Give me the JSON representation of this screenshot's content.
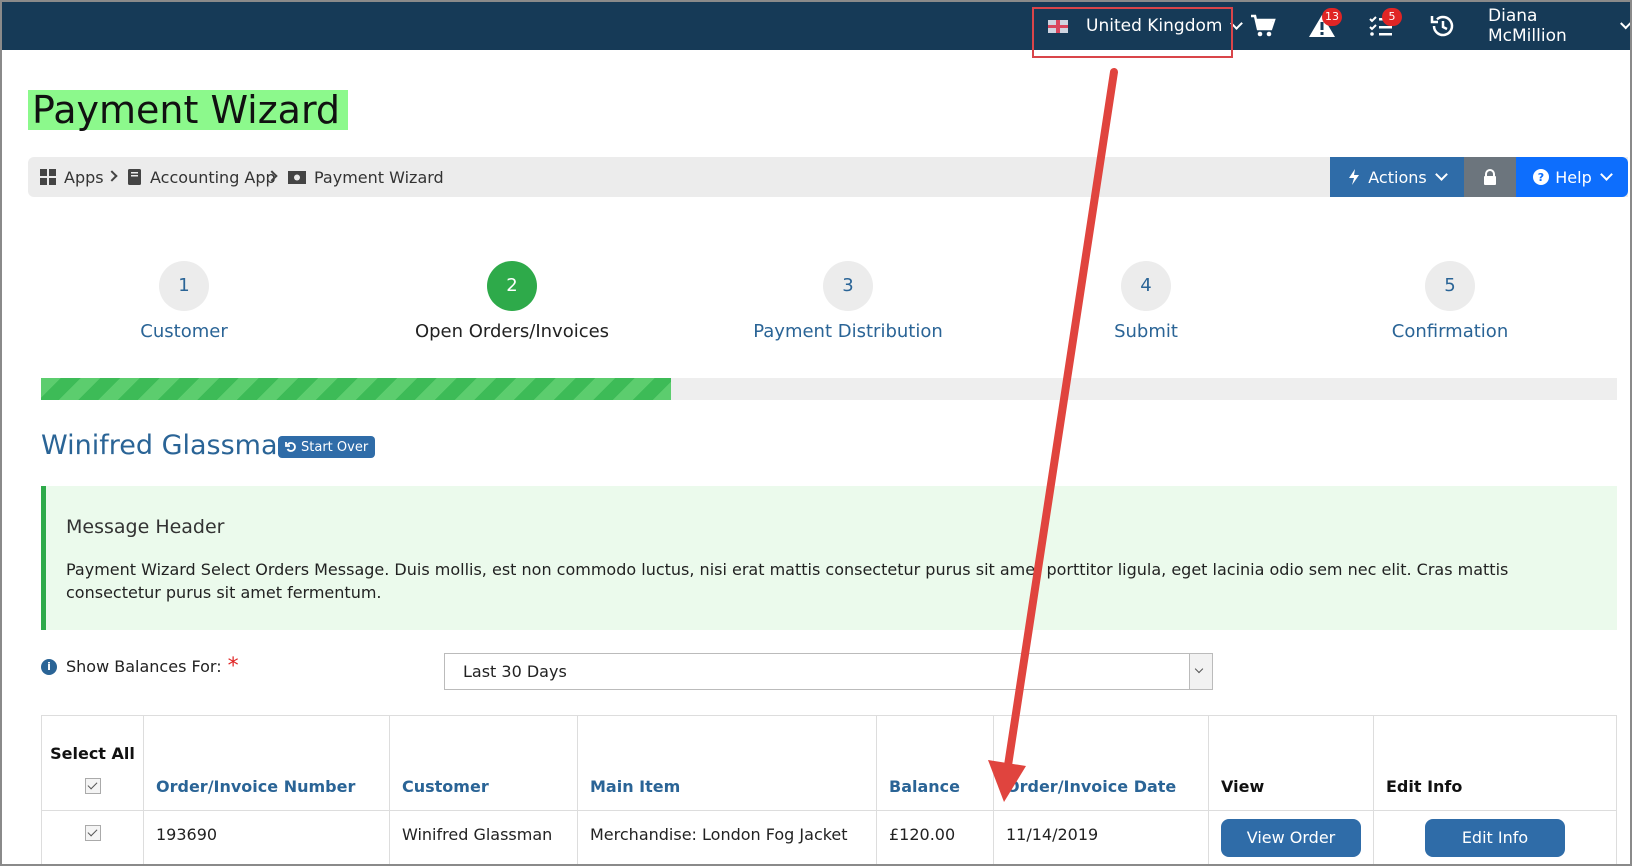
{
  "topbar": {
    "country": "United Kingdom",
    "alerts_count": "13",
    "tasks_count": "5",
    "user_name": "Diana McMillion"
  },
  "page": {
    "title": "Payment Wizard"
  },
  "breadcrumb": {
    "items": [
      "Apps",
      "Accounting App",
      "Payment Wizard"
    ],
    "actions_label": "Actions",
    "help_label": "Help"
  },
  "steps": [
    {
      "num": "1",
      "label": "Customer"
    },
    {
      "num": "2",
      "label": "Open Orders/Invoices"
    },
    {
      "num": "3",
      "label": "Payment Distribution"
    },
    {
      "num": "4",
      "label": "Submit"
    },
    {
      "num": "5",
      "label": "Confirmation"
    }
  ],
  "progress": {
    "percent": 40
  },
  "customer": {
    "name": "Winifred Glassman",
    "start_over": "Start Over"
  },
  "message": {
    "header": "Message Header",
    "body": "Payment Wizard Select Orders Message. Duis mollis, est non commodo luctus, nisi erat mattis consectetur purus sit amet porttitor ligula, eget lacinia odio sem nec elit. Cras mattis consectetur purus sit amet fermentum."
  },
  "filter": {
    "label": "Show Balances For:",
    "selected": "Last 30 Days"
  },
  "table": {
    "headers": {
      "select_all": "Select All",
      "number": "Order/Invoice Number",
      "customer": "Customer",
      "item": "Main Item",
      "balance": "Balance",
      "date": "Order/Invoice Date",
      "view": "View",
      "edit": "Edit Info"
    },
    "rows": [
      {
        "number": "193690",
        "customer": "Winifred Glassman",
        "item": "Merchandise: London Fog Jacket",
        "balance": "£120.00",
        "date": "11/14/2019",
        "view_label": "View Order",
        "edit_label": "Edit Info"
      }
    ]
  }
}
